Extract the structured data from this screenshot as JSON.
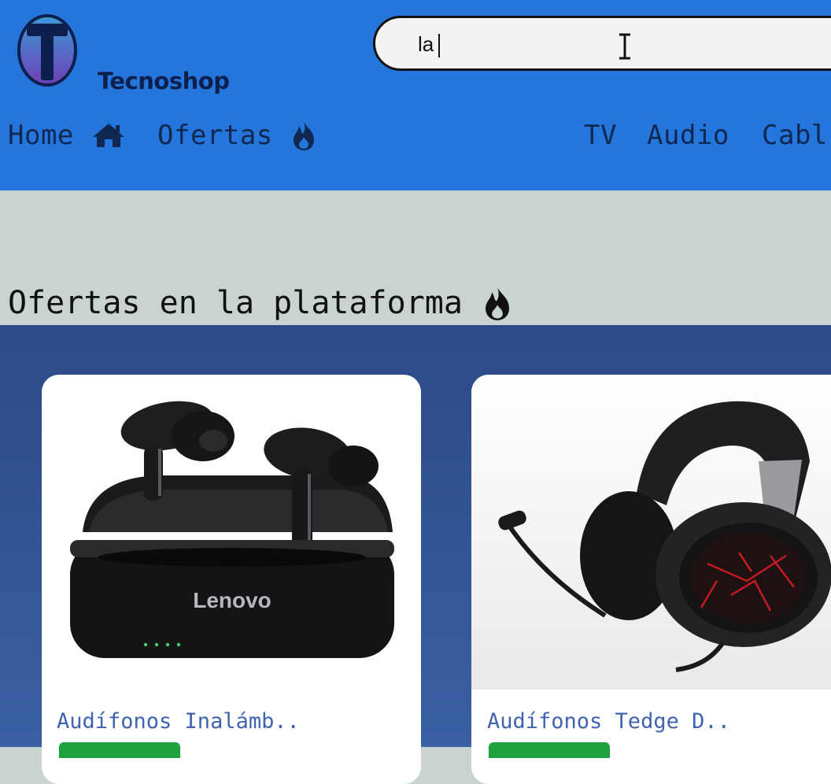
{
  "brand": {
    "name": "Tecnoshop",
    "accent": "#2576dc"
  },
  "search": {
    "value": "la",
    "placeholder": ""
  },
  "nav": {
    "left": [
      {
        "label": "Home",
        "icon": "home-icon"
      },
      {
        "label": "Ofertas",
        "icon": "fire-icon"
      }
    ],
    "right": [
      {
        "label": "TV"
      },
      {
        "label": "Audio"
      },
      {
        "label": "Cabl"
      }
    ]
  },
  "section": {
    "title": "Ofertas en la plataforma",
    "icon": "fire-icon"
  },
  "products": [
    {
      "name": "Audífonos Inalámb..",
      "image": "wireless-earbuds-image",
      "brand_mark": "Lenovo"
    },
    {
      "name": "Audífonos Tedge D..",
      "image": "gaming-headset-image"
    }
  ],
  "colors": {
    "header": "#2576dc",
    "strip": "#c9d3cf",
    "products_bg": "#2c4a86",
    "buy_button": "#1ea23e"
  }
}
